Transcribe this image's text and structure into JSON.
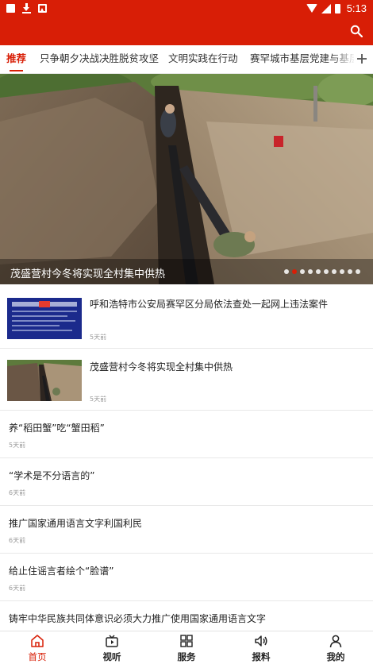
{
  "status_bar": {
    "time": "5:13"
  },
  "tabs": [
    {
      "label": "推荐",
      "active": true
    },
    {
      "label": "只争朝夕决战决胜脱贫攻坚"
    },
    {
      "label": "文明实践在行动"
    },
    {
      "label": "赛罕城市基层党建与基层"
    }
  ],
  "banner": {
    "title": "茂盛营村今冬将实现全村集中供热",
    "dot_count": 10,
    "active_dot": 1
  },
  "news": [
    {
      "title": "呼和浩特市公安局赛罕区分局依法查处一起网上违法案件",
      "time": "5天前",
      "thumb": "document-image"
    },
    {
      "title": "茂盛营村今冬将实现全村集中供热",
      "time": "5天前",
      "thumb": "pipeline-photo"
    },
    {
      "title": "养“稻田蟹”吃“蟹田稻”",
      "time": "5天前"
    },
    {
      "title": "“学术是不分语言的”",
      "time": "6天前"
    },
    {
      "title": "推广国家通用语言文字利国利民",
      "time": "6天前"
    },
    {
      "title": "给止住谣言者绘个“脸谱”",
      "time": "6天前"
    },
    {
      "title": "铸牢中华民族共同体意识必须大力推广使用国家通用语言文字",
      "time": ""
    }
  ],
  "bottom_nav": [
    {
      "label": "首页",
      "icon": "home-icon",
      "active": true
    },
    {
      "label": "视听",
      "icon": "video-icon"
    },
    {
      "label": "服务",
      "icon": "grid-icon"
    },
    {
      "label": "报料",
      "icon": "speaker-icon"
    },
    {
      "label": "我的",
      "icon": "user-icon"
    }
  ],
  "colors": {
    "accent": "#d81e06"
  }
}
